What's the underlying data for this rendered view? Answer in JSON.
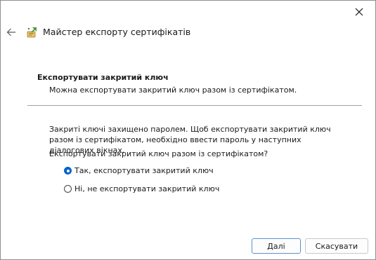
{
  "window": {
    "title": "Майстер експорту сертифікатів",
    "back_icon": "arrow-left-icon",
    "close_icon": "close-icon",
    "title_icon": "certificate-wizard-icon"
  },
  "section": {
    "heading": "Експортувати закритий ключ",
    "subheading": "Можна експортувати закритий ключ разом із сертифікатом."
  },
  "body": {
    "info": "Закриті ключі захищено паролем. Щоб експортувати закритий ключ разом із сертифікатом, необхідно ввести пароль у наступних діалогових вікнах.",
    "question": "Експортувати закритий ключ разом із сертифікатом?",
    "options": [
      {
        "label": "Так, експортувати закритий ключ",
        "selected": true
      },
      {
        "label": "Ні, не експортувати закритий ключ",
        "selected": false
      }
    ]
  },
  "buttons": {
    "next": "Далі",
    "cancel": "Скасувати"
  },
  "colors": {
    "accent": "#0064c8",
    "default_button_border": "#5a8fd0"
  }
}
